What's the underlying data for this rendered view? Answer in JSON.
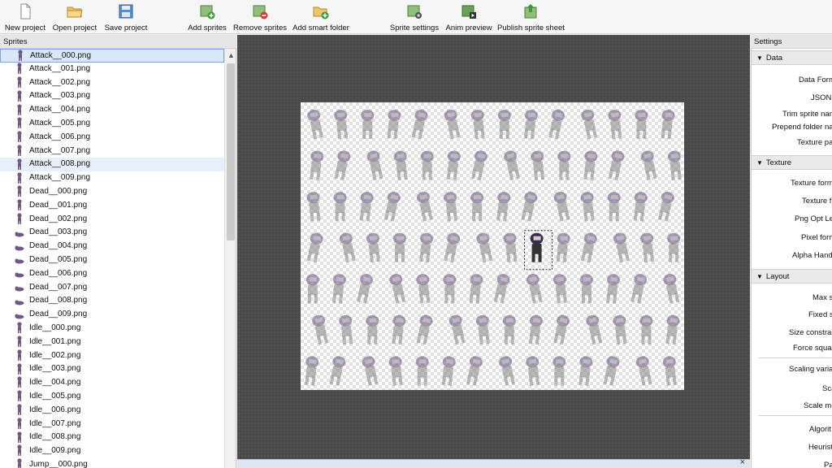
{
  "toolbar": {
    "new_project": "New project",
    "open_project": "Open project",
    "save_project": "Save project",
    "add_sprites": "Add sprites",
    "remove_sprites": "Remove sprites",
    "add_smart_folder": "Add smart folder",
    "sprite_settings": "Sprite settings",
    "anim_preview": "Anim preview",
    "publish_sprite_sheet": "Publish sprite sheet"
  },
  "sprites_panel": {
    "title": "Sprites",
    "items": [
      "Attack__000.png",
      "Attack__001.png",
      "Attack__002.png",
      "Attack__003.png",
      "Attack__004.png",
      "Attack__005.png",
      "Attack__006.png",
      "Attack__007.png",
      "Attack__008.png",
      "Attack__009.png",
      "Dead__000.png",
      "Dead__001.png",
      "Dead__002.png",
      "Dead__003.png",
      "Dead__004.png",
      "Dead__005.png",
      "Dead__006.png",
      "Dead__007.png",
      "Dead__008.png",
      "Dead__009.png",
      "Idle__000.png",
      "Idle__001.png",
      "Idle__002.png",
      "Idle__003.png",
      "Idle__004.png",
      "Idle__005.png",
      "Idle__006.png",
      "Idle__007.png",
      "Idle__008.png",
      "Idle__009.png",
      "Jump__000.png"
    ],
    "selected_index": 0,
    "hovered_index": 8
  },
  "settings_panel": {
    "title": "Settings",
    "data": {
      "header": "Data",
      "data_format": "Data Form",
      "json": "JSON f",
      "trim_sprite_names": "Trim sprite nam",
      "prepend_folder_name": "Prepend folder nar",
      "texture_path": "Texture pa"
    },
    "texture": {
      "header": "Texture",
      "texture_format": "Texture form",
      "texture_file": "Texture f",
      "png_opt_level": "Png Opt Lev",
      "pixel_format": "Pixel form",
      "alpha_handling": "Alpha Handli"
    },
    "layout": {
      "header": "Layout",
      "max_size": "Max si",
      "fixed_size": "Fixed si",
      "size_constraints": "Size constrair",
      "force_squared": "Force squar",
      "scaling_variants": "Scaling variar",
      "scale": "Sca",
      "scale_mode": "Scale mo",
      "algorithm": "Algorit",
      "heuristics": "Heurist",
      "pack": "Pa"
    }
  },
  "colors": {
    "selection": "#d9e8f8",
    "sprite_purple": "#6e5a80",
    "sprite_body": "#8c8c8c"
  }
}
